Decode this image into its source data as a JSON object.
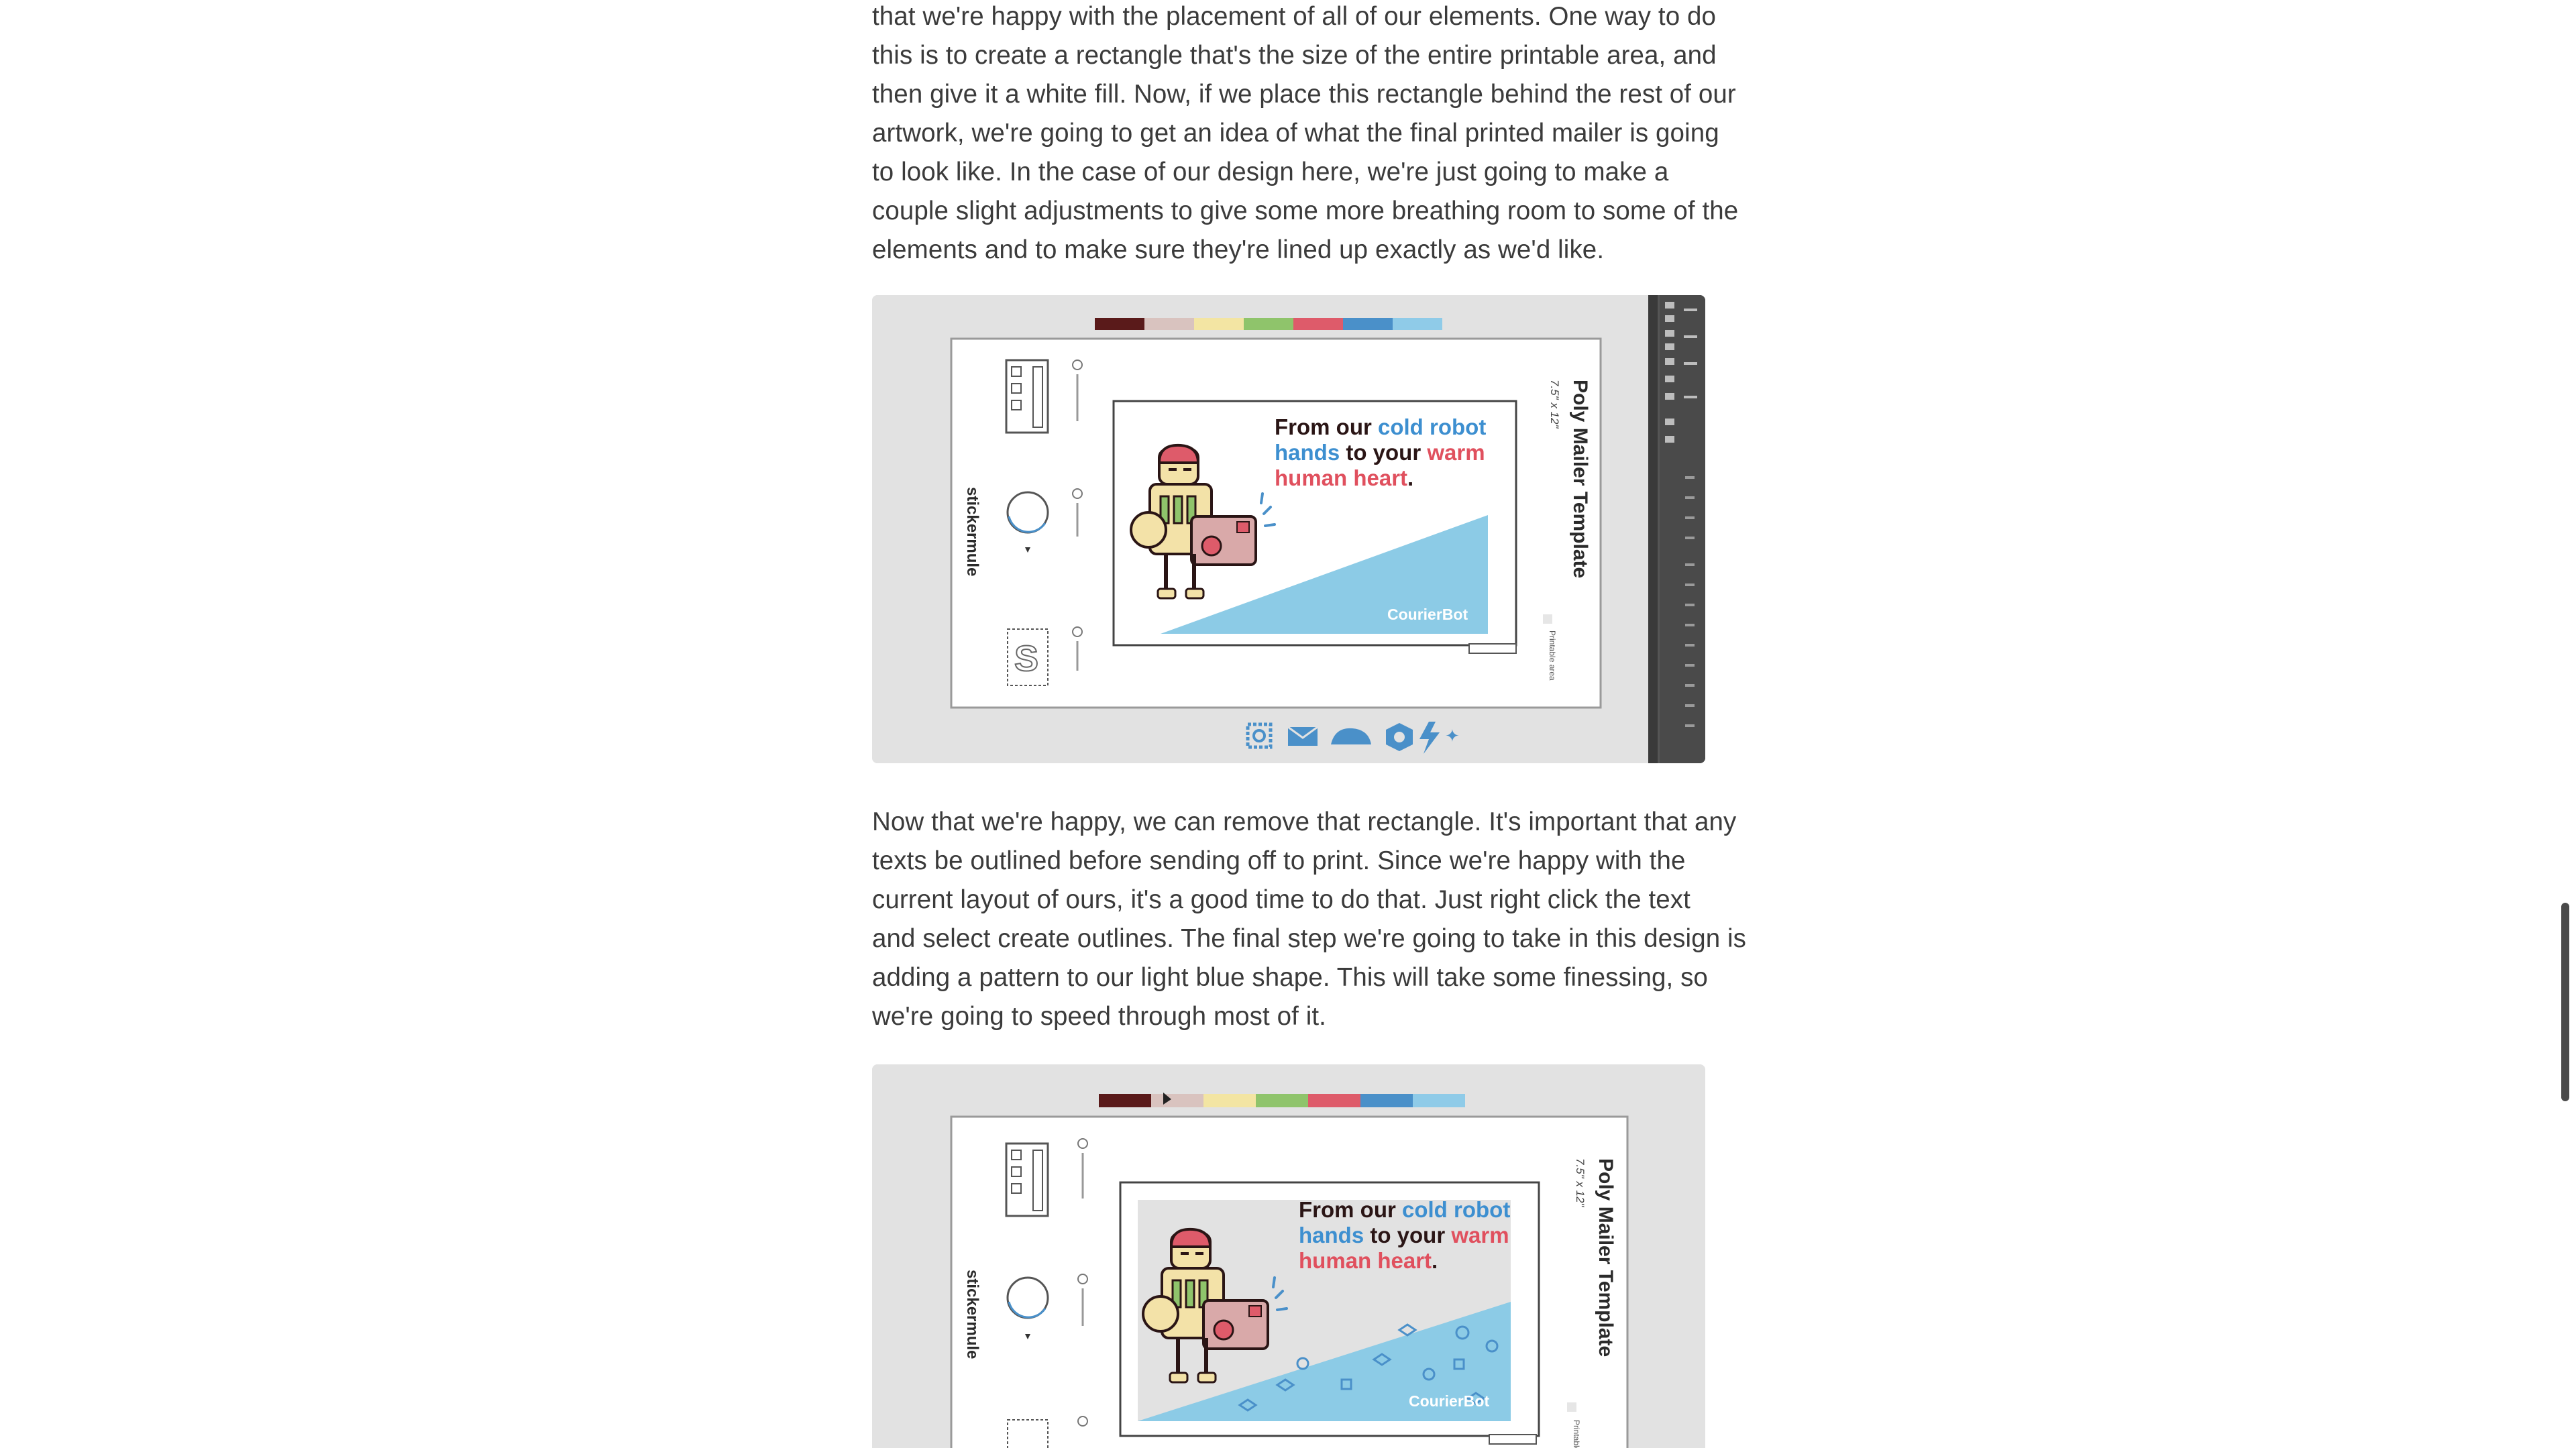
{
  "article": {
    "para1": [
      "that we're happy with the placement of all of our elements. One way to do",
      "this is to create a rectangle that's the size of the entire printable area, and",
      "then give it a white fill. Now, if we place this rectangle behind the rest of our",
      "artwork, we're going to get an idea of what the final printed mailer is going",
      "to look like. In the case of our design here, we're just going to make a",
      "couple slight adjustments to give some more breathing room to some of the",
      "elements and to make sure they're lined up exactly as we'd like."
    ],
    "para2": [
      "Now that we're happy, we can remove that rectangle. It's important that any",
      "texts be outlined before sending off to print. Since we're happy with the",
      "current layout of ours, it's a good time to do that. Just right click the text",
      "and select create outlines. The final step we're going to take in this design is",
      "adding a pattern to our light blue shape. This will take some finessing, so",
      "we're going to speed through most of it."
    ]
  },
  "mockup": {
    "headline_parts": {
      "from_our": "From our ",
      "cold_robot": "cold robot",
      "hands": "hands",
      "to_your": " to your ",
      "warm": "warm",
      "human_heart": "human heart",
      "period": "."
    },
    "brand_label": "CourierBot",
    "template_title": "Poly Mailer Template",
    "template_size": "7.5\" x 12\"",
    "logo_text": "stickermule",
    "printable_area": "Printable area"
  },
  "colors": {
    "swatches": [
      "#5a1a1a",
      "#d9c3bf",
      "#f3e5a3",
      "#8fc46b",
      "#de5b6a",
      "#4a90c9",
      "#8fcbe8"
    ],
    "sky_blue": "#8ccbe6",
    "blue_text": "#3d8fd0",
    "red_text": "#e0505e",
    "dark_text": "#2a1515",
    "screenshot_bg": "#e2e2e2",
    "panel_dark": "#555555"
  },
  "icons": [
    "stamp-icon",
    "envelope-icon",
    "cloud-icon",
    "package-icon",
    "lightning-icon",
    "sparkle-icon"
  ]
}
